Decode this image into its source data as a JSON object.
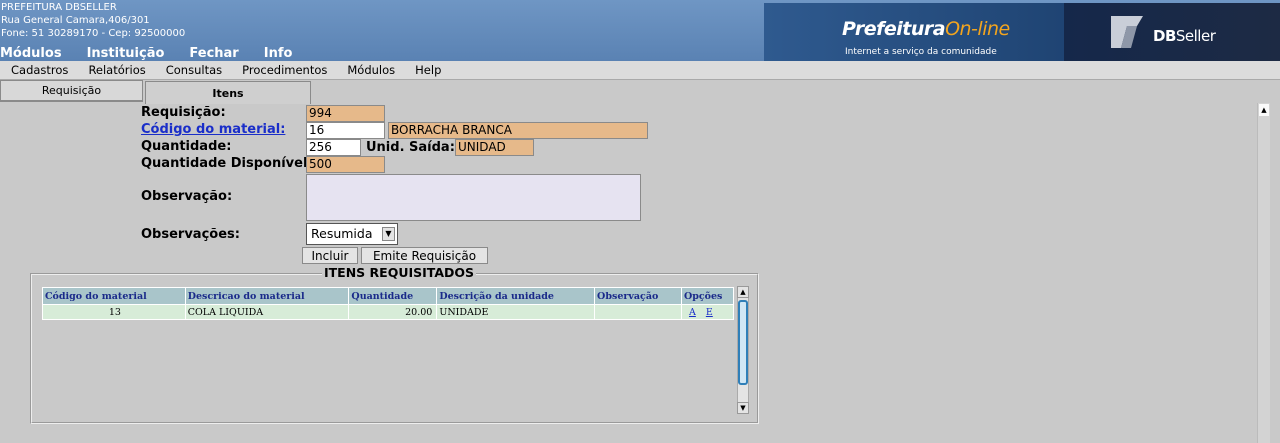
{
  "header": {
    "org_name": "PREFEITURA DBSELLER",
    "org_address": "Rua General Camara,406/301",
    "org_contact": "Fone: 51 30289170  -  Cep: 92500000",
    "top_menu": [
      "Módulos",
      "Instituição",
      "Fechar",
      "Info"
    ],
    "brand_prefeitura": "Prefeitura",
    "brand_online": "On-line",
    "brand_tagline": "Internet a serviço da comunidade",
    "brand_db": "DB",
    "brand_seller": "Seller"
  },
  "menubar": [
    "Cadastros",
    "Relatórios",
    "Consultas",
    "Procedimentos",
    "Módulos",
    "Help"
  ],
  "tabs": [
    {
      "label": "Requisição",
      "active": false
    },
    {
      "label": "Itens",
      "active": true
    }
  ],
  "form": {
    "requisicao_label": "Requisição:",
    "requisicao_value": "994",
    "codigo_label": "Código do material:",
    "codigo_value": "16",
    "material_desc": "BORRACHA BRANCA",
    "quantidade_label": "Quantidade:",
    "quantidade_value": "256",
    "unid_saida_label": "Unid. Saída:",
    "unid_saida_value": "UNIDAD",
    "qtd_disp_label": "Quantidade Disponível:",
    "qtd_disp_value": "500",
    "observacao_label": "Observação:",
    "observacao_value": "",
    "observacoes_label": "Observações:",
    "observacoes_selected": "Resumida",
    "incluir_label": "Incluir",
    "emite_label": "Emite Requisição"
  },
  "itens": {
    "legend": "ITENS REQUISITADOS",
    "columns": [
      "Código do material",
      "Descricao do material",
      "Quantidade",
      "Descrição da unidade",
      "Observação",
      "Opções"
    ],
    "rows": [
      {
        "codigo": "13",
        "descricao": "COLA LIQUIDA",
        "quantidade": "20.00",
        "unidade": "UNIDADE",
        "observacao": "",
        "opt_a": "A",
        "opt_e": "E"
      }
    ]
  }
}
